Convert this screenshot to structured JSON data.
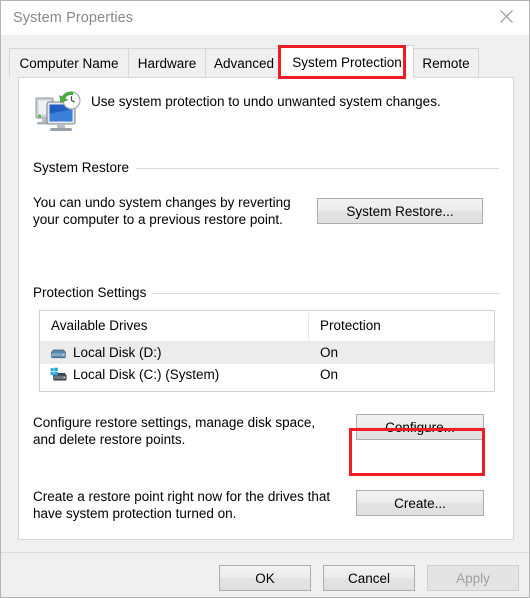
{
  "window": {
    "title": "System Properties",
    "close_icon": "close-icon"
  },
  "tabs": [
    {
      "label": "Computer Name",
      "selected": false
    },
    {
      "label": "Hardware",
      "selected": false
    },
    {
      "label": "Advanced",
      "selected": false
    },
    {
      "label": "System Protection",
      "selected": true
    },
    {
      "label": "Remote",
      "selected": false
    }
  ],
  "header": {
    "icon": "system-protection-icon",
    "description": "Use system protection to undo unwanted system changes."
  },
  "system_restore": {
    "group_title": "System Restore",
    "description_line1": "You can undo system changes by reverting",
    "description_line2": "your computer to a previous restore point.",
    "button_label": "System Restore..."
  },
  "protection_settings": {
    "group_title": "Protection Settings",
    "columns": {
      "drives": "Available Drives",
      "protection": "Protection"
    },
    "rows": [
      {
        "icon": "hard-drive-icon",
        "name": "Local Disk (D:)",
        "protection": "On",
        "selected": true
      },
      {
        "icon": "system-hard-drive-icon",
        "name": "Local Disk (C:) (System)",
        "protection": "On",
        "selected": false
      }
    ],
    "configure": {
      "description_line1": "Configure restore settings, manage disk space,",
      "description_line2": "and delete restore points.",
      "button_label": "Configure..."
    },
    "create": {
      "description_line1": "Create a restore point right now for the drives that",
      "description_line2": "have system protection turned on.",
      "button_label": "Create..."
    }
  },
  "footer": {
    "ok_label": "OK",
    "cancel_label": "Cancel",
    "apply_label": "Apply",
    "apply_disabled": true
  },
  "annotations": {
    "color": "#ee1c24",
    "targets": [
      "system-protection-tab",
      "configure-button"
    ]
  }
}
